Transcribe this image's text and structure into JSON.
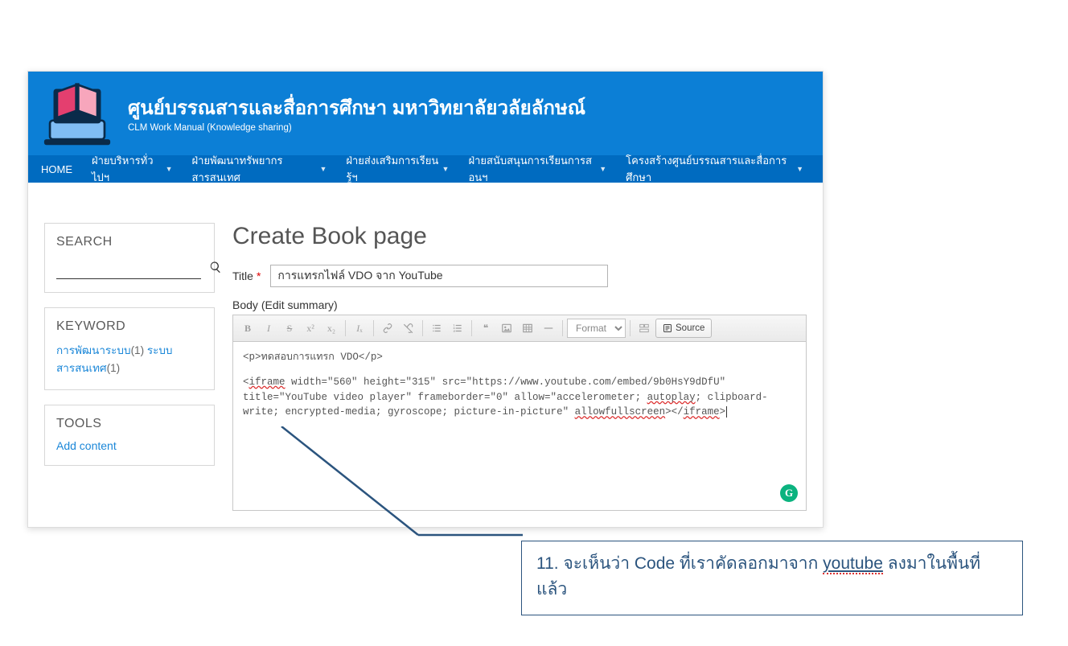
{
  "header": {
    "title": "ศูนย์บรรณสารและสื่อการศึกษา มหาวิทยาลัยวลัยลักษณ์",
    "subtitle": "CLM Work Manual (Knowledge sharing)"
  },
  "nav": {
    "home": "HOME",
    "items": [
      "ฝ่ายบริหารทั่วไปฯ",
      "ฝ่ายพัฒนาทรัพยากรสารสนเทศ",
      "ฝ่ายส่งเสริมการเรียนรู้ฯ",
      "ฝ่ายสนับสนุนการเรียนการสอนฯ",
      "โครงสร้างศูนย์บรรณสารและสื่อการศึกษา"
    ]
  },
  "sidebar": {
    "search_label": "SEARCH",
    "keyword_label": "KEYWORD",
    "keyword_item_1": "การพัฒนาระบบ",
    "keyword_count_1": "(1)",
    "keyword_item_2": "ระบบสารสนเทศ",
    "keyword_count_2": "(1)",
    "tools_label": "TOOLS",
    "tools_link": "Add content"
  },
  "main": {
    "page_title": "Create Book page",
    "title_field_label": "Title",
    "title_value": "การแทรกไฟล์ VDO จาก YouTube",
    "body_label_a": "Body ",
    "body_label_b": "(Edit summary)",
    "format_placeholder": "Format",
    "source_btn": "Source"
  },
  "editor_source": {
    "line1_open": "<p>",
    "line1_text": "ทดสอบการแทรก VDO",
    "line1_close": "</p>",
    "l2_a": "<",
    "l2_iframe": "iframe",
    "l2_b": " width=\"560\" height=\"315\" src=\"https://www.youtube.com/embed/9b0HsY9dDfU\" title=\"YouTube video player\" frameborder=\"0\" allow=\"accelerometer; ",
    "l2_autoplay": "autoplay",
    "l2_c": "; clipboard-write; encrypted-media; gyroscope; picture-in-picture\" ",
    "l2_allowfs": "allowfullscreen",
    "l2_d": "></",
    "l2_iframe2": "iframe",
    "l2_e": ">"
  },
  "callout": {
    "text_a": "11. จะเห็นว่า Code ที่เราคัดลอกมาจาก ",
    "text_b": "youtube",
    "text_c": " ลงมาในพื้นที่แล้ว"
  }
}
